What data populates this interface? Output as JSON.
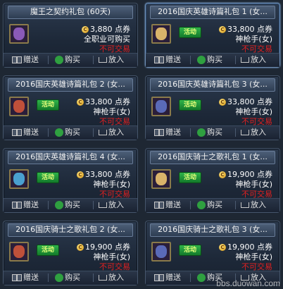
{
  "cards": [
    {
      "title": "魔王之契约礼包 (60天)",
      "badge": "",
      "price": "3,880 点券",
      "job": "全职业可购买",
      "trade": "不可交易",
      "gem": "#8a5ab8",
      "selected": false,
      "buttons": {
        "gift": "赠送",
        "buy": "购买",
        "put": "放入"
      }
    },
    {
      "title": "2016国庆英雄诗篇礼包 1 (女...",
      "badge": "活动",
      "price": "33,800 点券",
      "job": "神枪手(女)",
      "trade": "不可交易",
      "gem": "#d9b36a",
      "selected": true,
      "buttons": {
        "gift": "赠送",
        "buy": "购买",
        "put": "放入"
      }
    },
    {
      "title": "2016国庆英雄诗篇礼包 2 (女...",
      "badge": "活动",
      "price": "33,800 点券",
      "job": "神枪手(女)",
      "trade": "不可交易",
      "gem": "#c0503a",
      "selected": false,
      "buttons": {
        "gift": "赠送",
        "buy": "购买",
        "put": "放入"
      }
    },
    {
      "title": "2016国庆英雄诗篇礼包 3 (女...",
      "badge": "活动",
      "price": "33,800 点券",
      "job": "神枪手(女)",
      "trade": "不可交易",
      "gem": "#5a6ab8",
      "selected": false,
      "buttons": {
        "gift": "赠送",
        "buy": "购买",
        "put": "放入"
      }
    },
    {
      "title": "2016国庆英雄诗篇礼包 4 (女...",
      "badge": "活动",
      "price": "33,800 点券",
      "job": "神枪手(女)",
      "trade": "不可交易",
      "gem": "#4aa0d0",
      "selected": false,
      "buttons": {
        "gift": "赠送",
        "buy": "购买",
        "put": "放入"
      }
    },
    {
      "title": "2016国庆骑士之歌礼包 1 (女...",
      "badge": "活动",
      "price": "19,900 点券",
      "job": "神枪手(女)",
      "trade": "不可交易",
      "gem": "#d9b36a",
      "selected": false,
      "buttons": {
        "gift": "赠送",
        "buy": "购买",
        "put": "放入"
      }
    },
    {
      "title": "2016国庆骑士之歌礼包 2 (女...",
      "badge": "活动",
      "price": "19,900 点券",
      "job": "神枪手(女)",
      "trade": "不可交易",
      "gem": "#c0503a",
      "selected": false,
      "buttons": {
        "gift": "赠送",
        "buy": "购买",
        "put": "放入"
      }
    },
    {
      "title": "2016国庆骑士之歌礼包 3 (女...",
      "badge": "活动",
      "price": "19,900 点券",
      "job": "神枪手(女)",
      "trade": "不可交易",
      "gem": "#5a6ab8",
      "selected": false,
      "buttons": {
        "gift": "赠送",
        "buy": "购买",
        "put": "放入"
      }
    }
  ],
  "watermark": "bbs.duowan.com"
}
